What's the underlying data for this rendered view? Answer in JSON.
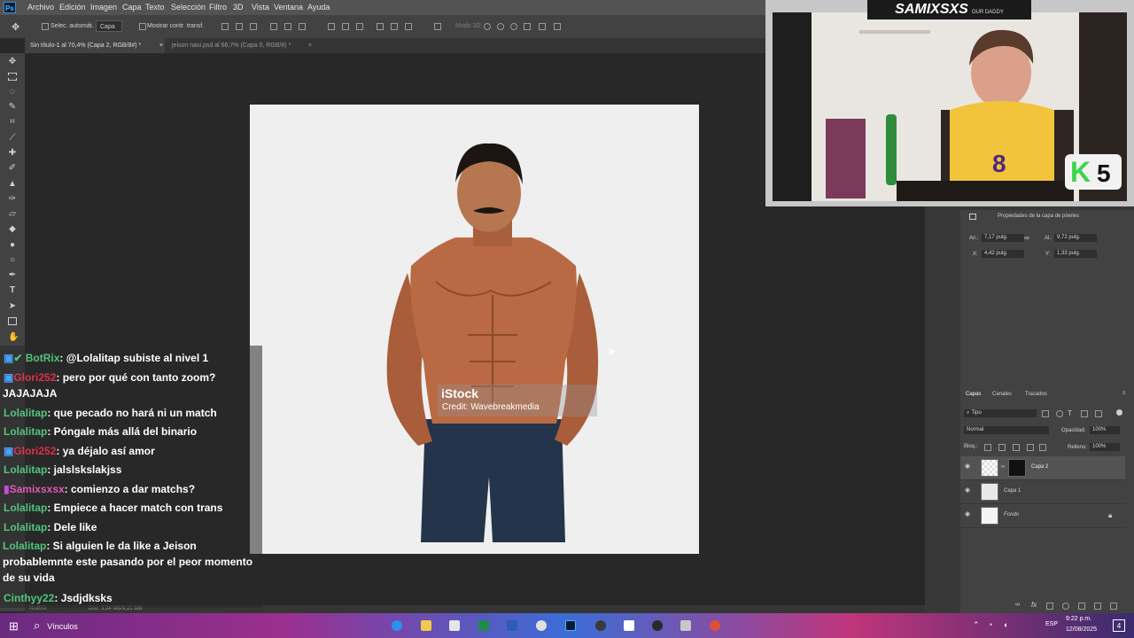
{
  "app": {
    "logo": "Ps"
  },
  "menu": [
    "Archivo",
    "Edición",
    "Imagen",
    "Capa",
    "Texto",
    "Selección",
    "Filtro",
    "3D",
    "Vista",
    "Ventana",
    "Ayuda"
  ],
  "options": {
    "auto_select_label": "Selec. automát.",
    "auto_select_value": "Capa",
    "show_transform_label": "Mostrar contr. transf.",
    "mode_3d": "Modo 3D:"
  },
  "tabs": [
    {
      "label": "Sin título-1 al 70,4% (Capa 2, RGB/8#) *",
      "close": "×"
    },
    {
      "label": "jeison nasi.psd al 66,7% (Capa 0, RGB/8) *",
      "close": "×"
    }
  ],
  "canvas": {
    "watermark_brand": "iStock",
    "watermark_credit": "Credit: Wavebreakmedia"
  },
  "status": {
    "zoom": "70,45%",
    "doc": "Doc: 3,34 MB/9,21 MB"
  },
  "properties": {
    "title": "Propiedades de la capa de píxeles",
    "an_label": "An.:",
    "an_value": "7,17 pulg.",
    "al_label": "Al.:",
    "al_value": "9,72 pulg.",
    "x_label": "X:",
    "x_value": "4,42 pulg.",
    "y_label": "Y:",
    "y_value": "1,33 pulg."
  },
  "layers_panel": {
    "tabs": [
      "Capas",
      "Canales",
      "Trazados"
    ],
    "filter": "Tipo",
    "blend_mode": "Normal",
    "opacity_label": "Opacidad:",
    "opacity_value": "100%",
    "lock_label": "Bloq.:",
    "fill_label": "Relleno:",
    "fill_value": "100%",
    "layers": [
      {
        "name": "Capa 2"
      },
      {
        "name": "Capa 1"
      },
      {
        "name": "Fondo"
      }
    ]
  },
  "webcam": {
    "banner": "SAMIXSXS",
    "banner_sub": "OUR DADDY",
    "badge": "5"
  },
  "chat": [
    {
      "user": "BotRix",
      "msg": ": @Lolalitap subiste al nivel 1",
      "color": "green"
    },
    {
      "user": "Glori252",
      "msg": ": pero por qué con tanto zoom?",
      "color": "red"
    },
    {
      "user": "",
      "msg": "JAJAJAJA",
      "color": "none"
    },
    {
      "user": "Lolalitap",
      "msg": ": que pecado no hará ni un match",
      "color": "green"
    },
    {
      "user": "Lolalitap",
      "msg": ": Póngale más allá del binario",
      "color": "green"
    },
    {
      "user": "Glori252",
      "msg": ": ya déjalo así amor",
      "color": "red"
    },
    {
      "user": "Lolalitap",
      "msg": ": jalslskslakjss",
      "color": "green"
    },
    {
      "user": "Samixsxsx",
      "msg": ": comienzo a dar matchs?",
      "color": "pink"
    },
    {
      "user": "Lolalitap",
      "msg": ": Empiece a hacer match con trans",
      "color": "green"
    },
    {
      "user": "Lolalitap",
      "msg": ": Dele like",
      "color": "green"
    },
    {
      "user": "Lolalitap",
      "msg": ": Si alguien le da like a Jeison probablemnte este pasando por el peor momento de su vida",
      "color": "green"
    },
    {
      "user": "Cinthyy22",
      "msg": ": Jsdjdksks",
      "color": "green"
    }
  ],
  "taskbar": {
    "search_label": "Vínculos",
    "time": "9:22 p.m.",
    "date": "12/08/2025",
    "lang": "ESP",
    "notif": "4"
  }
}
